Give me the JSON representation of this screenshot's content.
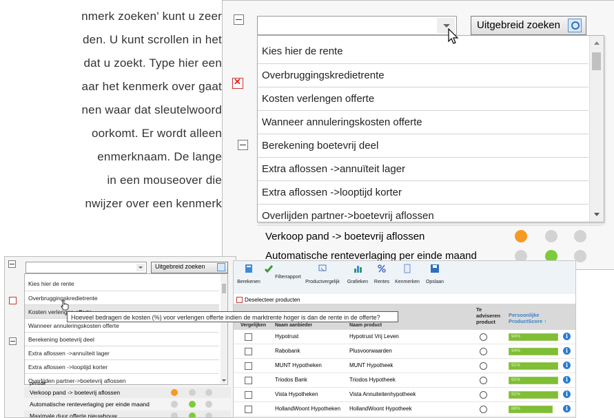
{
  "document": {
    "lines": [
      "nmerk zoeken' kunt u zeer",
      "den. U kunt scrollen in het",
      "dat u zoekt. Type hier een",
      "aar het kenmerk over gaat",
      "nen waar dat sleutelwoord",
      "oorkomt. Er wordt alleen",
      "enmerknaam.    De    lange",
      "in   een   mouseover   die",
      "nwijzer over een kenmerk"
    ]
  },
  "large_panel": {
    "search_value": "",
    "advanced_search_label": "Uitgebreid zoeken",
    "dropdown_items": [
      "Kies hier de rente",
      "Overbruggingskredietrente",
      "Kosten verlengen offerte",
      "Wanneer annuleringskosten offerte",
      "Berekening boetevrij deel",
      "Extra aflossen ->annuïteit lager",
      "Extra aflossen ->looptijd korter",
      "Overlijden partner->boetevrij aflossen"
    ],
    "rows_below": [
      {
        "label": "Verkoop pand -> boetevrij aflossen",
        "dots": [
          "#f59a23",
          "#d3d3d3",
          "#d3d3d3"
        ]
      },
      {
        "label": "Automatische renteverlaging per einde maand",
        "dots": [
          "#d3d3d3",
          "#7dcb3a",
          "#d3d3d3"
        ]
      }
    ]
  },
  "small_panel": {
    "search_value": "",
    "advanced_search_label": "Uitgebreid zoeken",
    "dropdown_items": [
      "Kies hier de rente",
      "Overbruggingskredietrente",
      "Kosten verlengen offerte",
      "Wanneer annuleringskosten offerte",
      "Berekening boetevrij deel",
      "Extra aflossen ->annuïteit lager",
      "Extra aflossen ->looptijd korter",
      "Overlijden partner->boetevrij aflossen"
    ],
    "partial_row": "periode",
    "rows_below": [
      {
        "label": "Verkoop pand -> boetevrij aflossen",
        "dots": [
          "#f59a23",
          "#d0d0d0",
          "#d0d0d0"
        ]
      },
      {
        "label": "Automatische renteverlaging per einde maand",
        "dots": [
          "#d0d0d0",
          "#7dcb3a",
          "#d0d0d0"
        ]
      },
      {
        "label": "Maximale duur offerte nieuwbouw",
        "dots": [
          "#d0d0d0",
          "#7dcb3a",
          "#d0d0d0"
        ]
      }
    ]
  },
  "tooltip": "Hoeveel bedragen de kosten (%) voor verlengen offerte indien de marktrente hoger is dan de rente in de offerte?",
  "results": {
    "toolbar": [
      {
        "label": "Berekenen",
        "icon": "calculator-icon",
        "color": "#3c8ad8"
      },
      {
        "label": "Filterrapport",
        "icon": "filter-check-icon",
        "color": "#3a9a3a"
      },
      {
        "label": "Productvergelijk",
        "icon": "compare-icon",
        "color": "#4a78c0"
      },
      {
        "label": "Grafieken",
        "icon": "chart-icon",
        "color": "#2e9a6b"
      },
      {
        "label": "Rentes",
        "icon": "percent-icon",
        "color": "#4f6fc6"
      },
      {
        "label": "Kenmerken",
        "icon": "list-icon",
        "color": "#6a8dd0"
      },
      {
        "label": "Opslaan",
        "icon": "save-icon",
        "color": "#2f6ec0"
      }
    ],
    "deselect_label": "Deselecteer producten",
    "headers": {
      "compare_header": "Vergelijken",
      "provider": "Naam aanbieder",
      "product": "Naam product",
      "advise": "Te adviseren product",
      "score": "Persoonlijke ProductScore ↑"
    },
    "rows": [
      {
        "provider": "Hypotrust",
        "product": "Hypotrust Vrij Leven",
        "score": "94%"
      },
      {
        "provider": "Rabobank",
        "product": "Plusvoorwaarden",
        "score": "94%"
      },
      {
        "provider": "MUNT Hypotheken",
        "product": "MUNT Hypotheek",
        "score": "91%"
      },
      {
        "provider": "Triodos Bank",
        "product": "Triodos Hypotheek",
        "score": "91%"
      },
      {
        "provider": "Vista Hypotheken",
        "product": "Vista Annuiteitenhypotheek",
        "score": "91%"
      },
      {
        "provider": "HollandWoont Hypotheken",
        "product": "HollandWoont Hypotheek",
        "score": "88%"
      }
    ]
  }
}
